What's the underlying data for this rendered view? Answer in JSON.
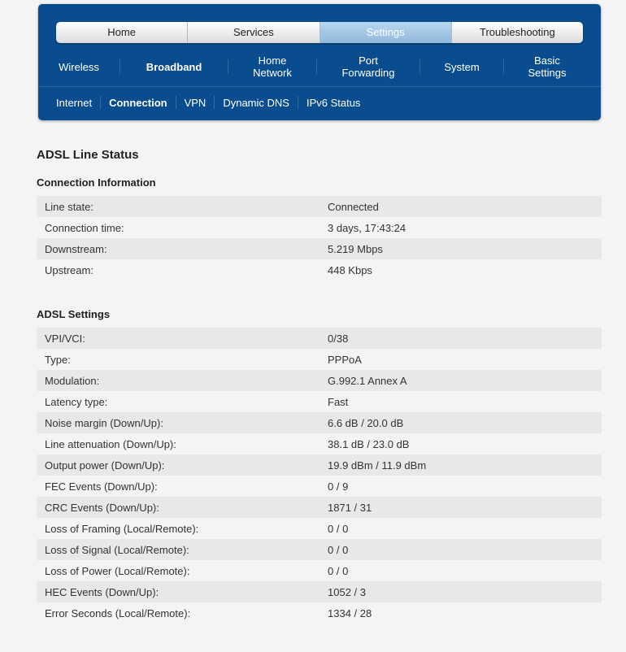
{
  "tabs": [
    "Home",
    "Services",
    "Settings",
    "Troubleshooting"
  ],
  "active_tab": 2,
  "subnav": [
    "Wireless",
    "Broadband",
    "Home\nNetwork",
    "Port\nForwarding",
    "System",
    "Basic\nSettings"
  ],
  "active_subnav": 1,
  "thirdnav": [
    "Internet",
    "Connection",
    "VPN",
    "Dynamic DNS",
    "IPv6 Status"
  ],
  "active_thirdnav": 1,
  "page_title": "ADSL Line Status",
  "connection_section": {
    "title": "Connection Information",
    "rows": [
      {
        "label": "Line state:",
        "value": "Connected"
      },
      {
        "label": "Connection time:",
        "value": "3 days, 17:43:24"
      },
      {
        "label": "Downstream:",
        "value": "5.219 Mbps"
      },
      {
        "label": "Upstream:",
        "value": "448 Kbps"
      }
    ]
  },
  "adsl_section": {
    "title": "ADSL Settings",
    "rows": [
      {
        "label": "VPI/VCI:",
        "value": "0/38"
      },
      {
        "label": "Type:",
        "value": "PPPoA"
      },
      {
        "label": "Modulation:",
        "value": "G.992.1 Annex A"
      },
      {
        "label": "Latency type:",
        "value": "Fast"
      },
      {
        "label": "Noise margin (Down/Up):",
        "value": "6.6 dB / 20.0 dB"
      },
      {
        "label": "Line attenuation (Down/Up):",
        "value": "38.1 dB / 23.0 dB"
      },
      {
        "label": "Output power (Down/Up):",
        "value": "19.9 dBm / 11.9 dBm"
      },
      {
        "label": "FEC Events (Down/Up):",
        "value": "0 / 9"
      },
      {
        "label": "CRC Events (Down/Up):",
        "value": "1871 / 31"
      },
      {
        "label": "Loss of Framing (Local/Remote):",
        "value": "0 / 0"
      },
      {
        "label": "Loss of Signal (Local/Remote):",
        "value": "0 / 0"
      },
      {
        "label": "Loss of Power (Local/Remote):",
        "value": "0 / 0"
      },
      {
        "label": "HEC Events (Down/Up):",
        "value": "1052 / 3"
      },
      {
        "label": "Error Seconds (Local/Remote):",
        "value": "1334 / 28"
      }
    ]
  }
}
